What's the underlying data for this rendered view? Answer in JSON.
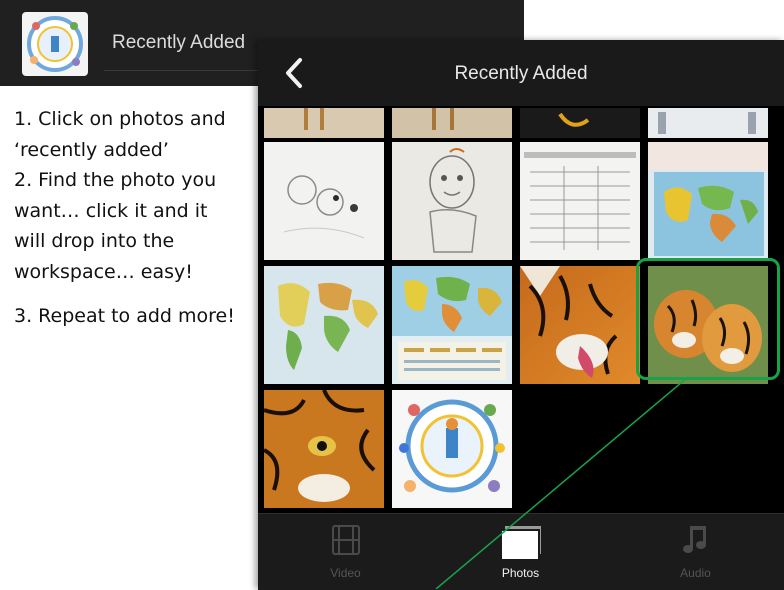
{
  "background_app": {
    "title": "Recently Added"
  },
  "instructions": {
    "step1": "1. Click on photos and ‘recently added’",
    "step2": "2. Find the photo you want… click it and it will drop into the workspace… easy!",
    "step3": "3. Repeat to add more!"
  },
  "picker": {
    "title": "Recently Added",
    "tabs": [
      {
        "label": "Video",
        "icon": "film-icon",
        "active": false
      },
      {
        "label": "Photos",
        "icon": "photos-icon",
        "active": true
      },
      {
        "label": "Audio",
        "icon": "music-note-icon",
        "active": false
      }
    ]
  },
  "colors": {
    "highlight": "#16a34a",
    "pointer_line": "#16a34a",
    "topbar": "#1a1a1a"
  }
}
